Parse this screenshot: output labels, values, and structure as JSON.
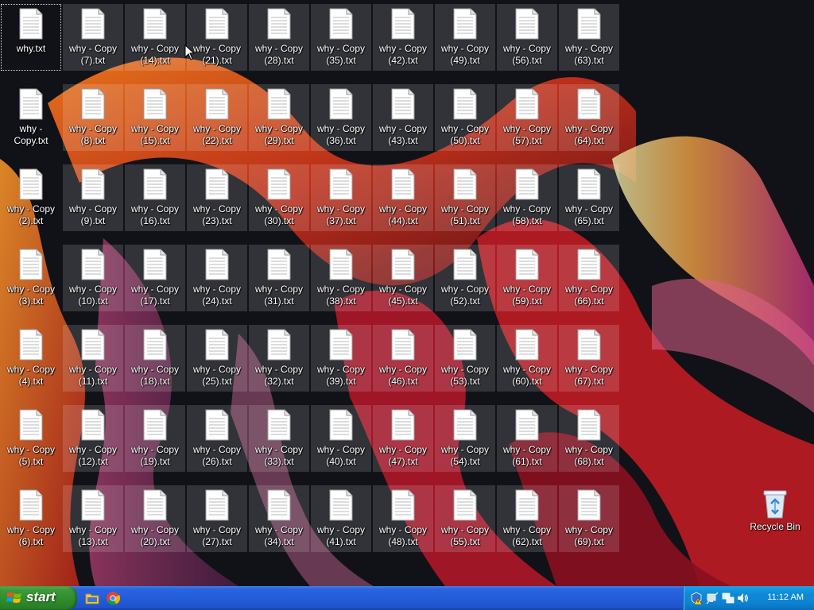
{
  "desktop": {
    "files": [
      {
        "label": "why.txt"
      },
      {
        "label": "why -\nCopy.txt"
      },
      {
        "label": "why - Copy\n(2).txt"
      },
      {
        "label": "why - Copy\n(3).txt"
      },
      {
        "label": "why - Copy\n(4).txt"
      },
      {
        "label": "why - Copy\n(5).txt"
      },
      {
        "label": "why - Copy\n(6).txt"
      },
      {
        "label": "why - Copy\n(7).txt"
      },
      {
        "label": "why - Copy\n(8).txt"
      },
      {
        "label": "why - Copy\n(9).txt"
      },
      {
        "label": "why - Copy\n(10).txt"
      },
      {
        "label": "why - Copy\n(11).txt"
      },
      {
        "label": "why - Copy\n(12).txt"
      },
      {
        "label": "why - Copy\n(13).txt"
      },
      {
        "label": "why - Copy\n(14).txt"
      },
      {
        "label": "why - Copy\n(15).txt"
      },
      {
        "label": "why - Copy\n(16).txt"
      },
      {
        "label": "why - Copy\n(17).txt"
      },
      {
        "label": "why - Copy\n(18).txt"
      },
      {
        "label": "why - Copy\n(19).txt"
      },
      {
        "label": "why - Copy\n(20).txt"
      },
      {
        "label": "why - Copy\n(21).txt"
      },
      {
        "label": "why - Copy\n(22).txt"
      },
      {
        "label": "why - Copy\n(23).txt"
      },
      {
        "label": "why - Copy\n(24).txt"
      },
      {
        "label": "why - Copy\n(25).txt"
      },
      {
        "label": "why - Copy\n(26).txt"
      },
      {
        "label": "why - Copy\n(27).txt"
      },
      {
        "label": "why - Copy\n(28).txt"
      },
      {
        "label": "why - Copy\n(29).txt"
      },
      {
        "label": "why - Copy\n(30).txt"
      },
      {
        "label": "why - Copy\n(31).txt"
      },
      {
        "label": "why - Copy\n(32).txt"
      },
      {
        "label": "why - Copy\n(33).txt"
      },
      {
        "label": "why - Copy\n(34).txt"
      },
      {
        "label": "why - Copy\n(35).txt"
      },
      {
        "label": "why - Copy\n(36).txt"
      },
      {
        "label": "why - Copy\n(37).txt"
      },
      {
        "label": "why - Copy\n(38).txt"
      },
      {
        "label": "why - Copy\n(39).txt"
      },
      {
        "label": "why - Copy\n(40).txt"
      },
      {
        "label": "why - Copy\n(41).txt"
      },
      {
        "label": "why - Copy\n(42).txt"
      },
      {
        "label": "why - Copy\n(43).txt"
      },
      {
        "label": "why - Copy\n(44).txt"
      },
      {
        "label": "why - Copy\n(45).txt"
      },
      {
        "label": "why - Copy\n(46).txt"
      },
      {
        "label": "why - Copy\n(47).txt"
      },
      {
        "label": "why - Copy\n(48).txt"
      },
      {
        "label": "why - Copy\n(49).txt"
      },
      {
        "label": "why - Copy\n(50).txt"
      },
      {
        "label": "why - Copy\n(51).txt"
      },
      {
        "label": "why - Copy\n(52).txt"
      },
      {
        "label": "why - Copy\n(53).txt"
      },
      {
        "label": "why - Copy\n(54).txt"
      },
      {
        "label": "why - Copy\n(55).txt"
      },
      {
        "label": "why - Copy\n(56).txt"
      },
      {
        "label": "why - Copy\n(57).txt"
      },
      {
        "label": "why - Copy\n(58).txt"
      },
      {
        "label": "why - Copy\n(59).txt"
      },
      {
        "label": "why - Copy\n(60).txt"
      },
      {
        "label": "why - Copy\n(61).txt"
      },
      {
        "label": "why - Copy\n(62).txt"
      },
      {
        "label": "why - Copy\n(63).txt"
      },
      {
        "label": "why - Copy\n(64).txt"
      },
      {
        "label": "why - Copy\n(65).txt"
      },
      {
        "label": "why - Copy\n(66).txt"
      },
      {
        "label": "why - Copy\n(67).txt"
      },
      {
        "label": "why - Copy\n(68).txt"
      },
      {
        "label": "why - Copy\n(69).txt"
      }
    ],
    "file_icon": "text-document-icon",
    "recycle_bin": {
      "label": "Recycle Bin",
      "icon": "recycle-bin-icon"
    }
  },
  "taskbar": {
    "start_label": "start",
    "start_icon": "windows-flag-icon",
    "quick_launch": [
      {
        "icon": "folder-icon"
      },
      {
        "icon": "chrome-icon"
      }
    ],
    "tray": {
      "icons": [
        "security-alert-icon",
        "network-disconnected-icon",
        "network-icon",
        "volume-icon"
      ],
      "clock": "11:12 AM"
    },
    "colors": {
      "taskbar": "#245ddb",
      "start": "#2f8b2c",
      "tray": "#0d83d2"
    }
  }
}
